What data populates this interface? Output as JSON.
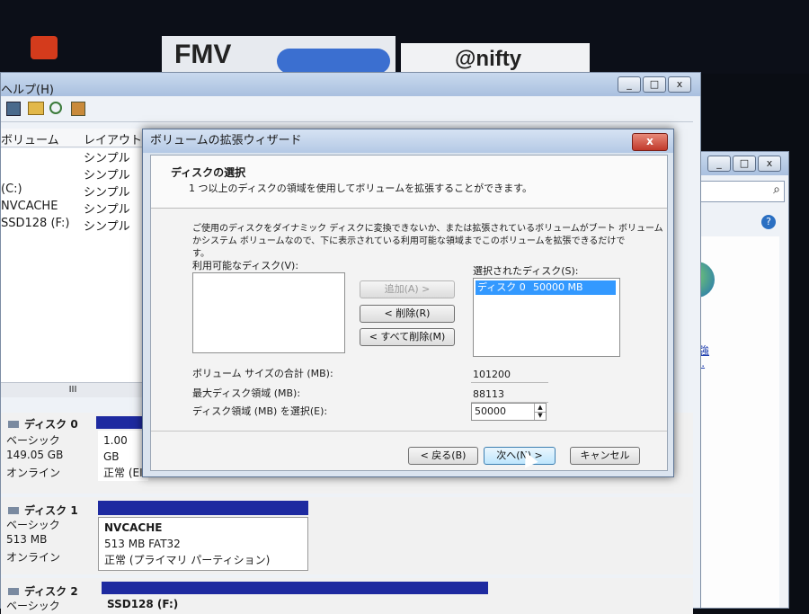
{
  "top_app": {
    "left_logo": "FMV",
    "right_logo": "@nifty"
  },
  "disk_mgmt": {
    "menu": {
      "help": "ヘルプ(H)"
    },
    "columns": {
      "volume": "ボリューム",
      "layout": "レイアウト"
    },
    "volumes": [
      {
        "name": "",
        "layout": "シンプル"
      },
      {
        "name": "",
        "layout": "シンプル"
      },
      {
        "name": "(C:)",
        "layout": "シンプル"
      },
      {
        "name": "NVCACHE",
        "layout": "シンプル"
      },
      {
        "name": "SSD128 (F:)",
        "layout": "シンプル"
      }
    ],
    "scroll_glyph": "III",
    "disks": [
      {
        "title": "ディスク 0",
        "type": "ベーシック",
        "size": "149.05 GB",
        "status": "オンライン",
        "partition": {
          "name": "",
          "size": "1.00 GB",
          "status": "正常 (EI"
        }
      },
      {
        "title": "ディスク 1",
        "type": "ベーシック",
        "size": "513 MB",
        "status": "オンライン",
        "partition": {
          "name": "NVCACHE",
          "size": "513 MB FAT32",
          "status": "正常 (プライマリ パーティション)"
        }
      },
      {
        "title": "ディスク 2",
        "type": "ベーシック",
        "size": "",
        "status": "",
        "partition": {
          "name": "SSD128 (F:)",
          "size": "",
          "status": ""
        }
      }
    ]
  },
  "right_window": {
    "link_text_1": "が強",
    "link_text_2": "d..."
  },
  "dialog": {
    "title": "ボリュームの拡張ウィザード",
    "close_glyph": "x",
    "heading": "ディスクの選択",
    "subheading": "1 つ以上のディスクの領域を使用してボリュームを拡張することができます。",
    "info_line_1": "ご使用のディスクをダイナミック ディスクに変換できないか、または拡張されているボリュームがブート ボリューム",
    "info_line_2": "かシステム ボリュームなので、下に表示されている利用可能な領域までこのボリュームを拡張できるだけで",
    "info_line_3": "す。",
    "available_label": "利用可能なディスク(V):",
    "selected_label": "選択されたディスク(S):",
    "selected_items": [
      {
        "disk": "ディスク 0",
        "size": "50000 MB"
      }
    ],
    "add_button": "追加(A) >",
    "remove_button": "< 削除(R)",
    "remove_all_button": "< すべて削除(M)",
    "total_size_label": "ボリューム サイズの合計 (MB):",
    "total_size_value": "101200",
    "max_space_label": "最大ディスク領域 (MB):",
    "max_space_value": "88113",
    "select_space_label": "ディスク領域 (MB) を選択(E):",
    "select_space_value": "50000",
    "back_button": "< 戻る(B)",
    "next_button": "次へ(N) >",
    "cancel_button": "キャンセル"
  }
}
